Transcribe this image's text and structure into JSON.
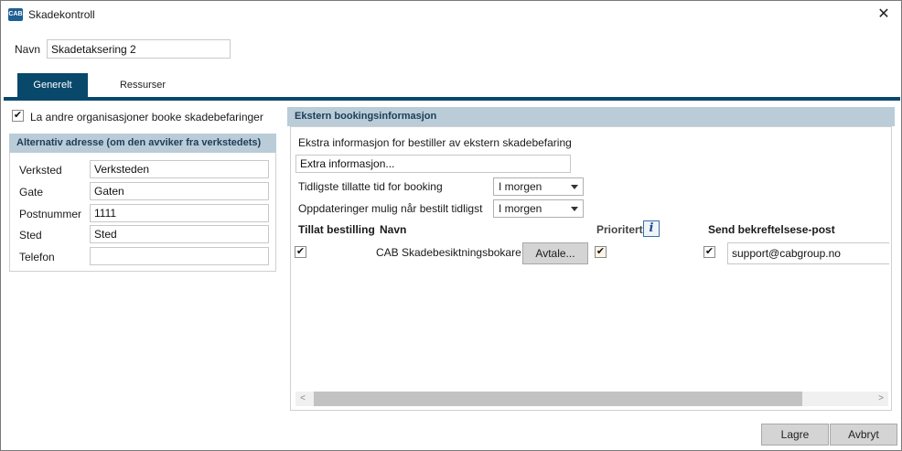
{
  "window": {
    "title": "Skadekontroll",
    "app_icon": "cab-logo-icon",
    "app_icon_text": "CAB",
    "close": "✕"
  },
  "name": {
    "label": "Navn",
    "value": "Skadetaksering 2"
  },
  "tabs": [
    {
      "label": "Generelt",
      "active": true
    },
    {
      "label": "Ressurser",
      "active": false
    }
  ],
  "allow_booking": {
    "label": "La andre organisasjoner booke skadebefaringer",
    "checked": true
  },
  "alt_address": {
    "header": "Alternativ adresse (om den avviker fra verkstedets)",
    "fields": [
      {
        "label": "Verksted",
        "value": "Verksteden"
      },
      {
        "label": "Gate",
        "value": "Gaten"
      },
      {
        "label": "Postnummer",
        "value": "1111"
      },
      {
        "label": "Sted",
        "value": "Sted"
      },
      {
        "label": "Telefon",
        "value": ""
      }
    ]
  },
  "external": {
    "header": "Ekstern bookingsinformasjon",
    "extra_label": "Ekstra informasjon for bestiller av ekstern skadebefaring",
    "extra_value": "Extra informasjon...",
    "earliest_label": "Tidligste tillatte tid for booking",
    "earliest_value": "I morgen",
    "updates_label": "Oppdateringer mulig når bestilt tidligst",
    "updates_value": "I morgen",
    "columns": {
      "allow": "Tillat bestilling",
      "name": "Navn",
      "priority": "Prioritert",
      "send": "Send bekreftelsese-post"
    },
    "rows": [
      {
        "allow": true,
        "name": "CAB Skadebesiktningsbokare",
        "button": "Avtale...",
        "priority": true,
        "send": true,
        "email": "support@cabgroup.no"
      }
    ]
  },
  "footer": {
    "save": "Lagre",
    "cancel": "Avbryt"
  },
  "colors": {
    "accent": "#08486b",
    "section_header": "#b9ccd8",
    "button": "#d4d4d4"
  }
}
